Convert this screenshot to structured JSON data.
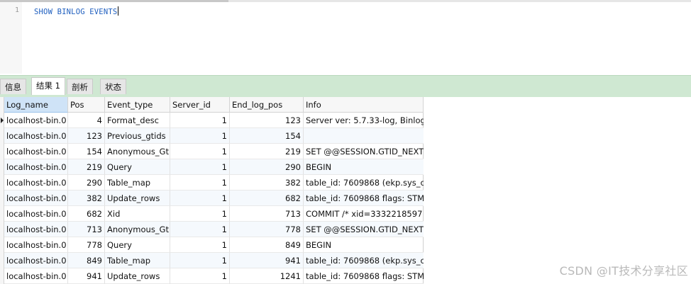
{
  "editor": {
    "line_number": "1",
    "query": "SHOW BINLOG EVENTS"
  },
  "tabs": [
    {
      "label": "信息",
      "active": false
    },
    {
      "label": "结果 1",
      "active": true
    },
    {
      "label": "剖析",
      "active": false
    },
    {
      "label": "状态",
      "active": false
    }
  ],
  "grid": {
    "columns": [
      "Log_name",
      "Pos",
      "Event_type",
      "Server_id",
      "End_log_pos",
      "Info"
    ],
    "rows": [
      [
        "localhost-bin.0",
        "4",
        "Format_desc",
        "1",
        "123",
        "Server ver: 5.7.33-log, Binlog"
      ],
      [
        "localhost-bin.0",
        "123",
        "Previous_gtids",
        "1",
        "154",
        ""
      ],
      [
        "localhost-bin.0",
        "154",
        "Anonymous_Gti",
        "1",
        "219",
        "SET @@SESSION.GTID_NEXT"
      ],
      [
        "localhost-bin.0",
        "219",
        "Query",
        "1",
        "290",
        "BEGIN"
      ],
      [
        "localhost-bin.0",
        "290",
        "Table_map",
        "1",
        "382",
        "table_id: 7609868 (ekp.sys_cl"
      ],
      [
        "localhost-bin.0",
        "382",
        "Update_rows",
        "1",
        "682",
        "table_id: 7609868 flags: STM"
      ],
      [
        "localhost-bin.0",
        "682",
        "Xid",
        "1",
        "713",
        "COMMIT /* xid=3332218597"
      ],
      [
        "localhost-bin.0",
        "713",
        "Anonymous_Gti",
        "1",
        "778",
        "SET @@SESSION.GTID_NEXT"
      ],
      [
        "localhost-bin.0",
        "778",
        "Query",
        "1",
        "849",
        "BEGIN"
      ],
      [
        "localhost-bin.0",
        "849",
        "Table_map",
        "1",
        "941",
        "table_id: 7609868 (ekp.sys_cl"
      ],
      [
        "localhost-bin.0",
        "941",
        "Update_rows",
        "1",
        "1241",
        "table_id: 7609868 flags: STM"
      ]
    ]
  },
  "watermark": "CSDN @IT技术分享社区"
}
